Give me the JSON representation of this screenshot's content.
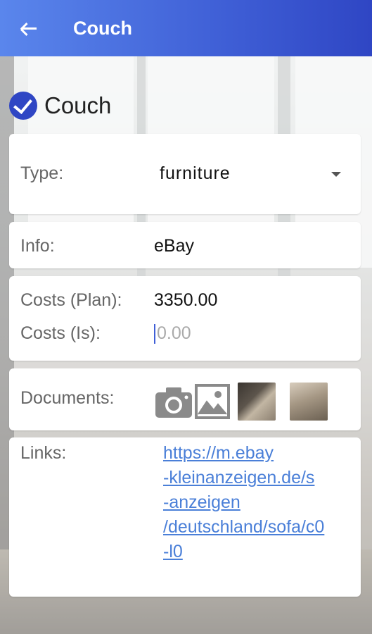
{
  "appbar": {
    "title": "Couch"
  },
  "heading": {
    "text": "Couch"
  },
  "type_row": {
    "label": "Type:",
    "value": "furniture"
  },
  "info_row": {
    "label": "Info:",
    "value": "eBay"
  },
  "costs": {
    "plan_label": "Costs (Plan):",
    "plan_value": "3350.00",
    "is_label": "Costs (Is):",
    "is_placeholder": "0.00"
  },
  "documents": {
    "label": "Documents:",
    "icons": [
      "camera-icon",
      "image-icon"
    ],
    "thumbnail_count": 2
  },
  "links": {
    "label": "Links:",
    "lines": [
      "https://m.ebay",
      "-kleinanzeigen.de/s",
      "-anzeigen",
      "/deutschland/sofa/c0",
      "-l0"
    ]
  },
  "colors": {
    "appbar_start": "#5a86ec",
    "appbar_end": "#2f46c4",
    "link": "#4a7fd8",
    "accent": "#2f46c4"
  }
}
